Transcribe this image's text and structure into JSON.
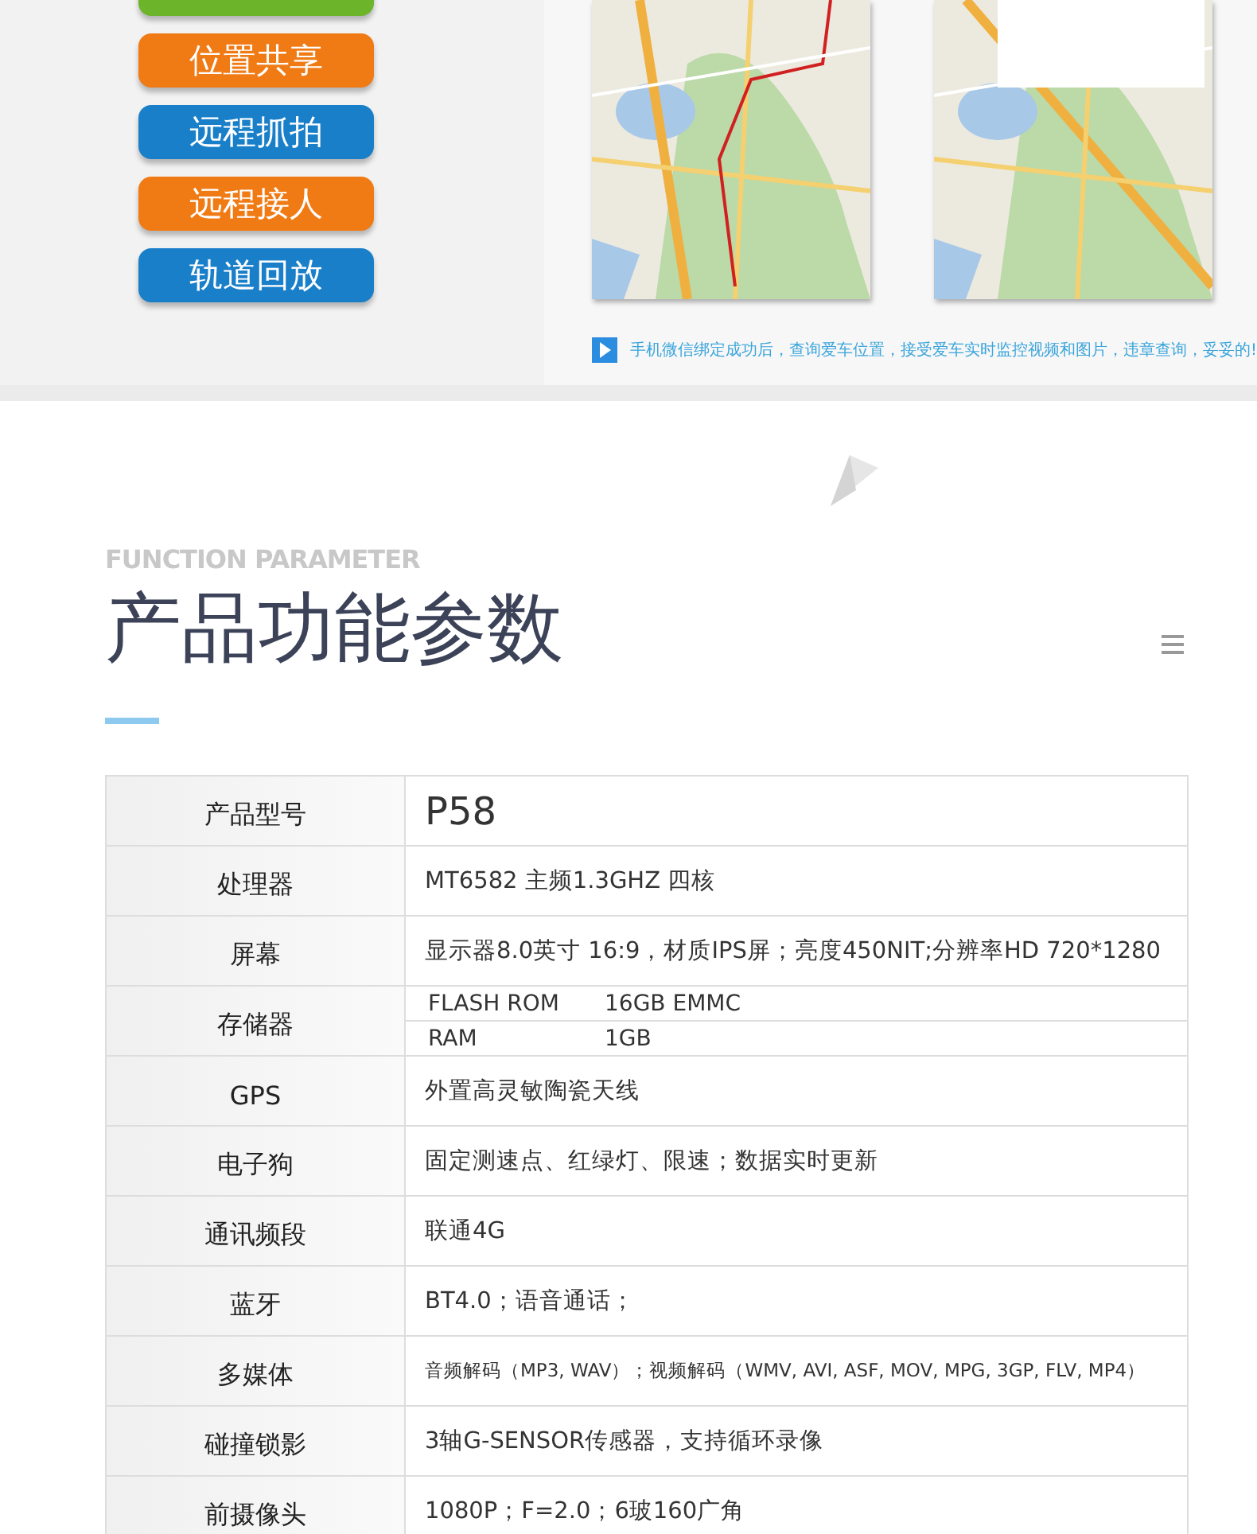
{
  "features": [
    {
      "color": "#6cb52a"
    },
    {
      "label": "位置共享",
      "color": "#f07a14"
    },
    {
      "label": "远程抓拍",
      "color": "#1a7fc9"
    },
    {
      "label": "远程接人",
      "color": "#f07a14"
    },
    {
      "label": "轨道回放",
      "color": "#1a7fc9"
    }
  ],
  "caption": "手机微信绑定成功后，查询爱车位置，接受爱车实时监控视频和图片，违章查询，妥妥的!",
  "section": {
    "subtitle": "FUNCTION PARAMETER",
    "title": "产品功能参数"
  },
  "table": {
    "rows": [
      {
        "kind": "model",
        "label": "产品型号",
        "value": "P58"
      },
      {
        "kind": "text",
        "label": "处理器",
        "value": "MT6582  主频1.3GHZ 四核"
      },
      {
        "kind": "text",
        "label": "屏幕",
        "value": "显示器8.0英寸 16:9，材质IPS屏；亮度450NIT;分辨率HD 720*1280"
      },
      {
        "kind": "split",
        "label": "存储器",
        "entries": [
          {
            "name": "FLASH ROM",
            "value": "16GB EMMC"
          },
          {
            "name": "RAM",
            "value": "1GB"
          }
        ]
      },
      {
        "kind": "text",
        "label": "GPS",
        "value": "外置高灵敏陶瓷天线"
      },
      {
        "kind": "text",
        "label": "电子狗",
        "value": "固定测速点、红绿灯、限速；数据实时更新"
      },
      {
        "kind": "text",
        "label": "通讯频段",
        "value": "联通4G"
      },
      {
        "kind": "text",
        "label": "蓝牙",
        "value": "BT4.0；语音通话；"
      },
      {
        "kind": "small",
        "label": "多媒体",
        "value": "音频解码（MP3, WAV）；视频解码（WMV, AVI, ASF, MOV, MPG, 3GP, FLV, MP4）"
      },
      {
        "kind": "text",
        "label": "碰撞锁影",
        "value": "3轴G-SENSOR传感器，支持循环录像"
      },
      {
        "kind": "text",
        "label": "前摄像头",
        "value": "1080P；F=2.0；6玻160广角"
      }
    ]
  }
}
